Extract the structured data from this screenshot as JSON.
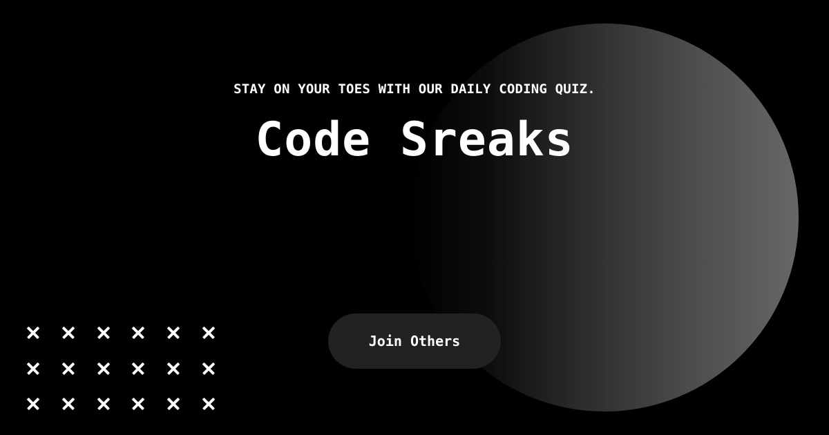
{
  "hero": {
    "tagline": "STAY ON YOUR TOES WITH OUR DAILY CODING QUIZ.",
    "title": "Code Sreaks",
    "cta_label": "Join Others"
  },
  "decor": {
    "orb": "gradient-circle",
    "pattern_icon": "close-icon",
    "pattern_rows": 3,
    "pattern_cols": 6
  },
  "colors": {
    "background": "#000000",
    "text": "#ffffff",
    "button": "#232223",
    "orb_light": "#676767"
  }
}
